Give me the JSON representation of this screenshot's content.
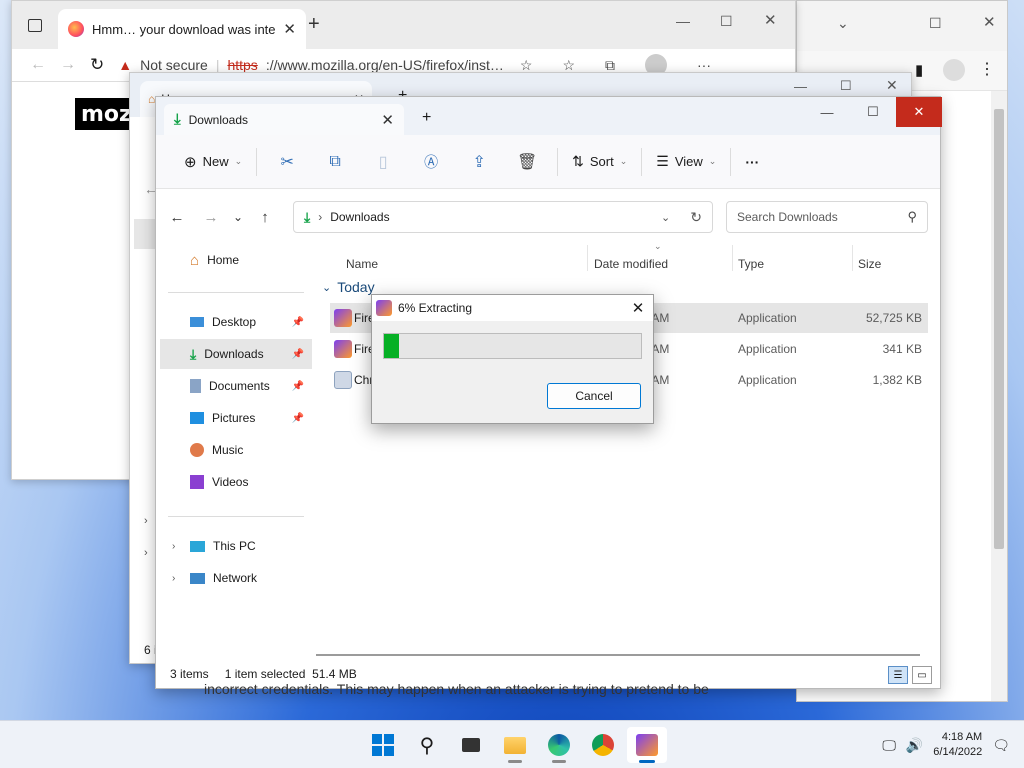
{
  "browser": {
    "tab_title": "Hmm… your download was inte",
    "security_label": "Not secure",
    "url_https": "https",
    "url_rest": "://www.mozilla.org/en-US/firefox/inst…",
    "logo_text": "moz",
    "page_text_fragment": "incorrect credentials. This may happen when an attacker is trying to pretend to be"
  },
  "explorer_home": {
    "tab_title": "Home",
    "status_fragment": "6 i"
  },
  "explorer": {
    "tab_title": "Downloads",
    "toolbar": {
      "new_label": "New",
      "sort_label": "Sort",
      "view_label": "View",
      "more_label": "···"
    },
    "breadcrumb": "Downloads",
    "search_placeholder": "Search Downloads",
    "sidebar": {
      "home": "Home",
      "pinned": [
        {
          "label": "Desktop"
        },
        {
          "label": "Downloads"
        },
        {
          "label": "Documents"
        },
        {
          "label": "Pictures"
        },
        {
          "label": "Music"
        },
        {
          "label": "Videos"
        }
      ],
      "this_pc": "This PC",
      "network": "Network"
    },
    "columns": {
      "name": "Name",
      "date": "Date modified",
      "type": "Type",
      "size": "Size"
    },
    "group_label": "Today",
    "files": [
      {
        "name": "Fire",
        "date": ":18 AM",
        "type": "Application",
        "size": "52,725 KB"
      },
      {
        "name": "Fire",
        "date": ":17 AM",
        "type": "Application",
        "size": "341 KB"
      },
      {
        "name": "Chr",
        "date": ":13 AM",
        "type": "Application",
        "size": "1,382 KB"
      }
    ],
    "status": {
      "items": "3 items",
      "selected": "1 item selected  51.4 MB"
    }
  },
  "dialog": {
    "title": "6% Extracting",
    "progress_percent": 6,
    "cancel_label": "Cancel"
  },
  "taskbar": {
    "time": "4:18 AM",
    "date": "6/14/2022"
  },
  "colors": {
    "accent": "#0067c0",
    "close_red": "#c42b1c",
    "progress_green": "#06b025"
  }
}
